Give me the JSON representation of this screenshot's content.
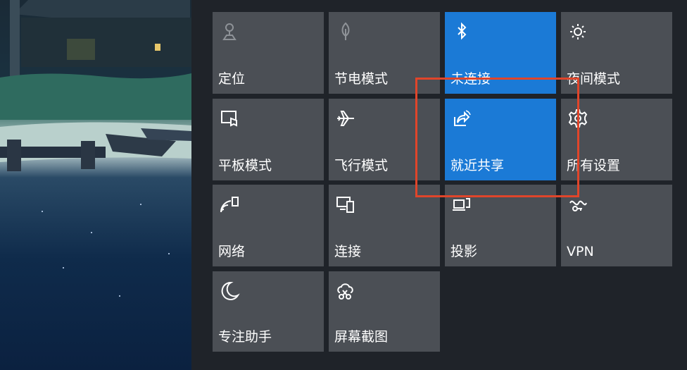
{
  "accent_color": "#1b7ad6",
  "highlight_color": "#e0452a",
  "quick_actions": [
    {
      "label": "定位",
      "icon": "location-icon",
      "state": "disabled"
    },
    {
      "label": "节电模式",
      "icon": "battery-saver-icon",
      "state": "disabled"
    },
    {
      "label": "未连接",
      "icon": "bluetooth-icon",
      "state": "on"
    },
    {
      "label": "夜间模式",
      "icon": "night-light-icon",
      "state": "off"
    },
    {
      "label": "平板模式",
      "icon": "tablet-mode-icon",
      "state": "off"
    },
    {
      "label": "飞行模式",
      "icon": "airplane-icon",
      "state": "off"
    },
    {
      "label": "就近共享",
      "icon": "nearby-share-icon",
      "state": "on"
    },
    {
      "label": "所有设置",
      "icon": "gear-icon",
      "state": "off"
    },
    {
      "label": "网络",
      "icon": "network-icon",
      "state": "off"
    },
    {
      "label": "连接",
      "icon": "connect-icon",
      "state": "off"
    },
    {
      "label": "投影",
      "icon": "project-icon",
      "state": "off"
    },
    {
      "label": "VPN",
      "icon": "vpn-icon",
      "state": "off"
    },
    {
      "label": "专注助手",
      "icon": "focus-assist-icon",
      "state": "off"
    },
    {
      "label": "屏幕截图",
      "icon": "screen-snip-icon",
      "state": "off"
    }
  ]
}
